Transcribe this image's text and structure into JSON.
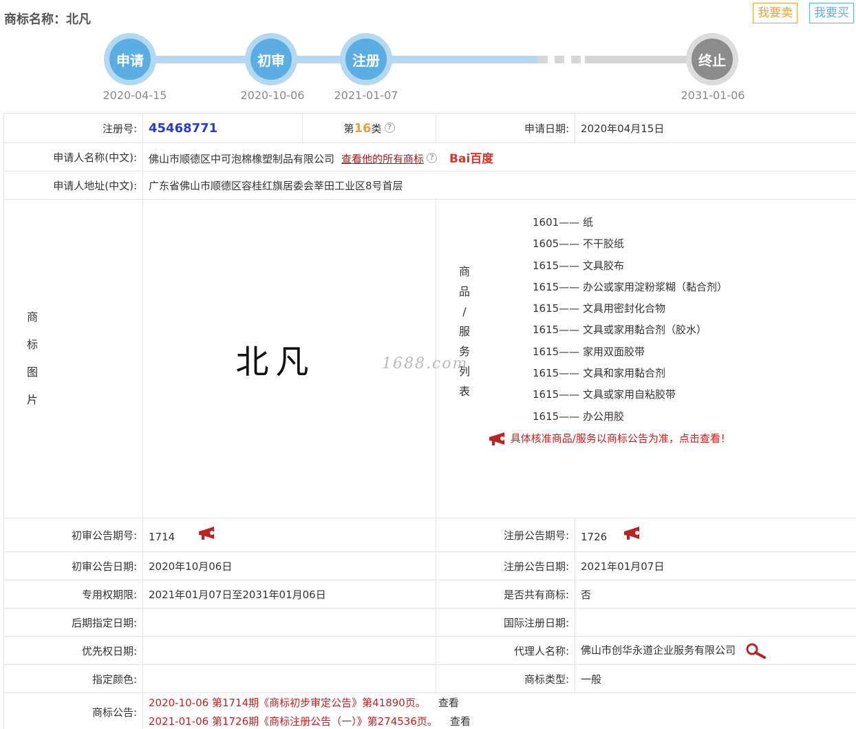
{
  "header": {
    "title": "商标名称：北凡",
    "sell_label": "我要卖",
    "buy_label": "我要买"
  },
  "timeline": {
    "steps": [
      {
        "label": "申请",
        "date": "2020-04-15"
      },
      {
        "label": "初审",
        "date": "2020-10-06"
      },
      {
        "label": "注册",
        "date": "2021-01-07"
      },
      {
        "label": "终止",
        "date": "2031-01-06"
      }
    ]
  },
  "info": {
    "reg_no_label": "注册号:",
    "reg_no": "45468771",
    "class_prefix": "第",
    "class_num": "16",
    "class_suffix": "类",
    "apply_date_label": "申请日期:",
    "apply_date": "2020年04月15日",
    "applicant_label": "申请人名称(中文):",
    "applicant": "佛山市顺德区中可泡棉橡塑制品有限公司",
    "all_marks_link": "查看他的所有商标",
    "baidu_label": "Bai百度",
    "address_label": "申请人地址(中文):",
    "address": "广东省佛山市顺德区容桂红旗居委会莘田工业区8号首层",
    "image_label": "商标图片",
    "mark_text": "北凡",
    "goods_label": "商品/服务列表",
    "goods": [
      "1601—— 纸",
      "1605—— 不干胶纸",
      "1615—— 文具胶布",
      "1615—— 办公或家用淀粉浆糊（黏合剂）",
      "1615—— 文具用密封化合物",
      "1615—— 文具或家用黏合剂（胶水）",
      "1615—— 家用双面胶带",
      "1615—— 文具和家用黏合剂",
      "1615—— 文具或家用自粘胶带",
      "1615—— 办公用胶"
    ],
    "goods_note": "具体核准商品/服务以商标公告为准，点击查看！",
    "watermark": "1688.com",
    "prelim_no_label": "初审公告期号:",
    "prelim_no": "1714",
    "reg_notice_no_label": "注册公告期号:",
    "reg_notice_no": "1726",
    "prelim_date_label": "初审公告日期:",
    "prelim_date": "2020年10月06日",
    "reg_notice_date_label": "注册公告日期:",
    "reg_notice_date": "2021年01月07日",
    "term_label": "专用权期限:",
    "term": "2021年01月07日至2031年01月06日",
    "shared_label": "是否共有商标:",
    "shared": "否",
    "later_date_label": "后期指定日期:",
    "later_date": "",
    "intl_date_label": "国际注册日期:",
    "intl_date": "",
    "priority_label": "优先权日期:",
    "priority": "",
    "agent_label": "代理人名称:",
    "agent": "佛山市创华永道企业服务有限公司",
    "color_label": "指定颜色:",
    "color": "",
    "type_label": "商标类型:",
    "type": "一般",
    "notice_label": "商标公告:",
    "notices": [
      {
        "text": "2020-10-06 第1714期《商标初步审定公告》第41890页。",
        "view": "查看"
      },
      {
        "text": "2021-01-06 第1726期《商标注册公告（一）》第274536页。",
        "view": "查看"
      }
    ]
  }
}
